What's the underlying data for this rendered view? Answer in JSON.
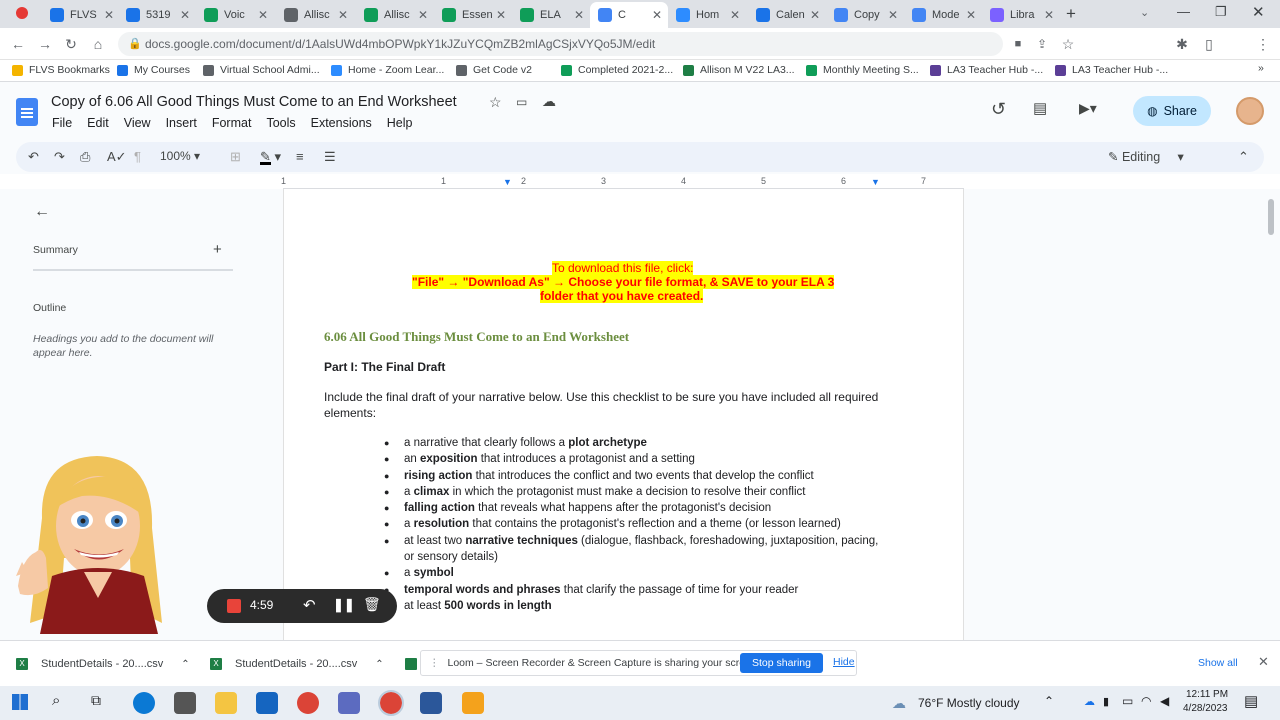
{
  "tabs": [
    {
      "label": "FLVS",
      "color": "#1a73e8"
    },
    {
      "label": "5319",
      "color": "#1a73e8"
    },
    {
      "label": "Voic",
      "color": "#0f9d58"
    },
    {
      "label": "Allisc",
      "color": "#5f6368"
    },
    {
      "label": "Allisc",
      "color": "#0f9d58"
    },
    {
      "label": "Essen",
      "color": "#0f9d58"
    },
    {
      "label": "ELA",
      "color": "#0f9d58"
    },
    {
      "label": "C",
      "color": "#4285f4"
    },
    {
      "label": "Hom",
      "color": "#2d8cff"
    },
    {
      "label": "Calen",
      "color": "#1a73e8"
    },
    {
      "label": "Copy",
      "color": "#4285f4"
    },
    {
      "label": "Mode",
      "color": "#4285f4"
    },
    {
      "label": "Libra",
      "color": "#7b61ff"
    }
  ],
  "browser": {
    "url": "docs.google.com/document/d/1AalsUWd4mbOPWpkY1kJZuYCQmZB2mlAgCSjxVYQo5JM/edit"
  },
  "bookmarks": [
    {
      "label": "FLVS Bookmarks",
      "color": "#f4b400"
    },
    {
      "label": "My Courses",
      "color": "#1a73e8"
    },
    {
      "label": "Virtual School Admi...",
      "color": "#5f6368"
    },
    {
      "label": "Home - Zoom Lear...",
      "color": "#2d8cff"
    },
    {
      "label": "Get Code v2",
      "color": "#5f6368"
    },
    {
      "label": "Completed 2021-2...",
      "color": "#0f9d58"
    },
    {
      "label": "Allison M V22 LA3...",
      "color": "#1e7e45"
    },
    {
      "label": "Monthly Meeting S...",
      "color": "#0f9d58"
    },
    {
      "label": "LA3 Teacher Hub -...",
      "color": "#5b3e96"
    },
    {
      "label": "LA3 Teacher Hub -...",
      "color": "#5b3e96"
    }
  ],
  "doc": {
    "title": "Copy of 6.06 All Good Things Must Come to an End Worksheet",
    "menu": [
      "File",
      "Edit",
      "View",
      "Insert",
      "Format",
      "Tools",
      "Extensions",
      "Help"
    ],
    "share_label": "Share",
    "zoom": "100%",
    "mode": "Editing",
    "ruler_ticks": [
      "1",
      "1",
      "2",
      "3",
      "4",
      "5",
      "6",
      "7"
    ]
  },
  "sidebar": {
    "summary_label": "Summary",
    "outline_label": "Outline",
    "outline_hint": "Headings you add to the document will appear here."
  },
  "content": {
    "download_line1": "To download this file, click:",
    "download_line2": "\"File\" → \"Download As\" → Choose your file format, & SAVE to your ELA 3",
    "download_line3": "folder that you have created.",
    "worksheet_title": "6.06 All Good Things Must Come to an End Worksheet",
    "part_heading": "Part I: The Final Draft",
    "intro": "Include the final draft of your narrative below. Use this checklist to be sure you have included all required elements:",
    "checklist": [
      {
        "pre": "a narrative that clearly follows a ",
        "bold": "plot archetype",
        "post": ""
      },
      {
        "pre": "an ",
        "bold": "exposition",
        "post": " that introduces a protagonist and a setting"
      },
      {
        "pre": "",
        "bold": "rising action",
        "post": " that introduces the conflict and two events that develop the conflict"
      },
      {
        "pre": "a ",
        "bold": "climax",
        "post": " in which the protagonist must make a decision to resolve their conflict"
      },
      {
        "pre": "",
        "bold": "falling action",
        "post": " that reveals what happens after the protagonist's decision"
      },
      {
        "pre": "a ",
        "bold": "resolution",
        "post": " that contains the protagonist's reflection and a theme (or lesson learned)"
      },
      {
        "pre": "at least two ",
        "bold": "narrative techniques",
        "post": " (dialogue, flashback, foreshadowing, juxtaposition, pacing, or sensory details)"
      },
      {
        "pre": "a ",
        "bold": "symbol",
        "post": ""
      },
      {
        "pre": "",
        "bold": "temporal words and phrases",
        "post": " that clarify the passage of time for your reader"
      },
      {
        "pre": "at least ",
        "bold": "500 words in length",
        "post": ""
      }
    ]
  },
  "loom": {
    "timer": "4:59",
    "share_notice": "Loom – Screen Recorder & Screen Capture is sharing your screen.",
    "stop_label": "Stop sharing",
    "hide_label": "Hide"
  },
  "downloads": [
    {
      "label": "StudentDetails - 20....csv"
    },
    {
      "label": "StudentDetails - 20....csv"
    }
  ],
  "downloads_show_all": "Show all",
  "taskbar": {
    "weather": "76°F  Mostly cloudy",
    "time": "12:11 PM",
    "date": "4/28/2023"
  }
}
